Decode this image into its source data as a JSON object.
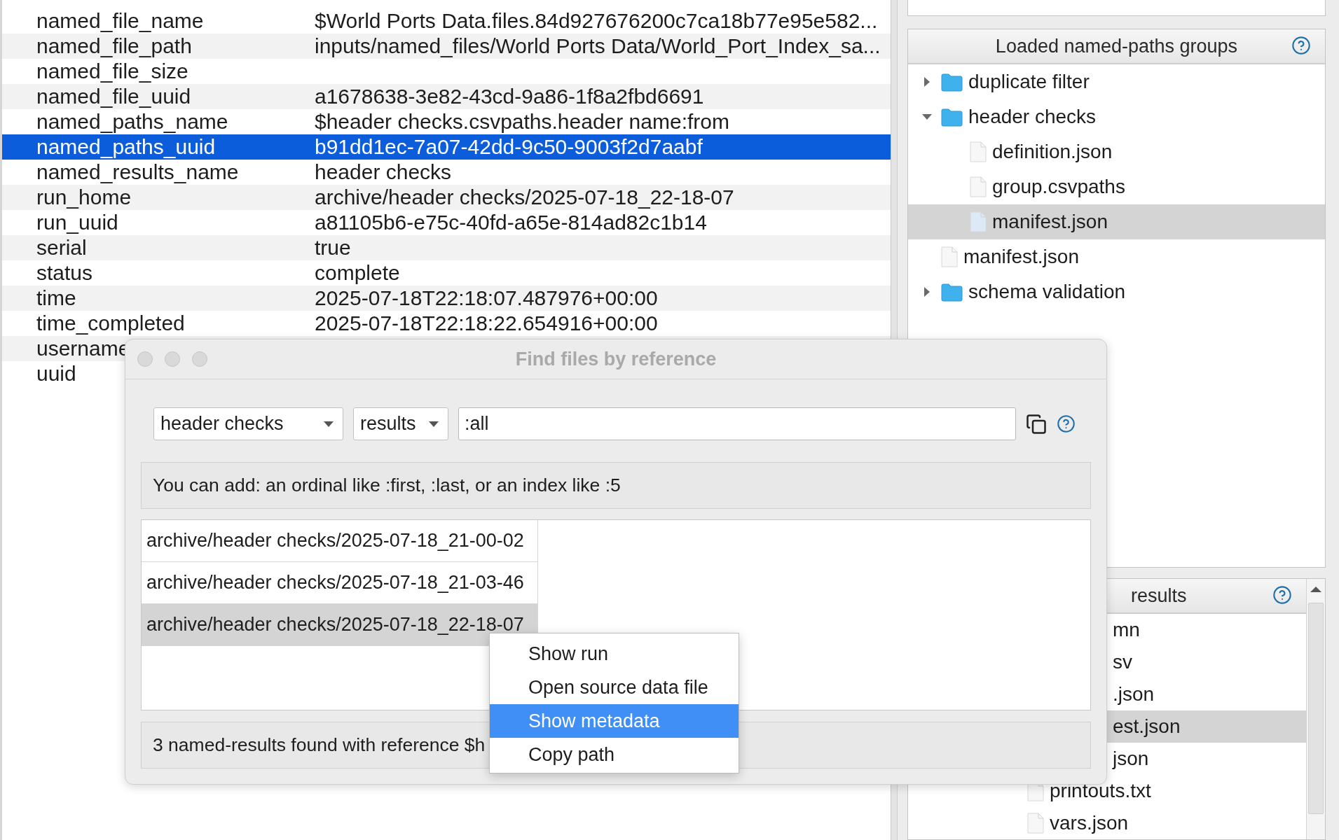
{
  "metadata_table": {
    "rows": [
      {
        "key": "named_file_name",
        "value": "$World Ports Data.files.84d927676200c7ca18b77e95e582...",
        "selected": false
      },
      {
        "key": "named_file_path",
        "value": "inputs/named_files/World Ports Data/World_Port_Index_sa...",
        "selected": false
      },
      {
        "key": "named_file_size",
        "selected": false
      },
      {
        "key": "named_file_uuid",
        "value": "a1678638-3e82-43cd-9a86-1f8a2fbd6691",
        "selected": false
      },
      {
        "key": "named_paths_name",
        "value": "$header checks.csvpaths.header name:from",
        "selected": false
      },
      {
        "key": "named_paths_uuid",
        "value": "b91dd1ec-7a07-42dd-9c50-9003f2d7aabf",
        "selected": true
      },
      {
        "key": "named_results_name",
        "value": "header checks",
        "selected": false
      },
      {
        "key": "run_home",
        "value": "archive/header checks/2025-07-18_22-18-07",
        "selected": false
      },
      {
        "key": "run_uuid",
        "value": "a81105b6-e75c-40fd-a65e-814ad82c1b14",
        "selected": false
      },
      {
        "key": "serial",
        "value": "true",
        "selected": false
      },
      {
        "key": "status",
        "value": "complete",
        "selected": false
      },
      {
        "key": "time",
        "value": "2025-07-18T22:18:07.487976+00:00",
        "selected": false
      },
      {
        "key": "time_completed",
        "value": "2025-07-18T22:18:22.654916+00:00",
        "selected": false
      },
      {
        "key": "username",
        "selected": false
      },
      {
        "key": "uuid",
        "selected": false
      }
    ]
  },
  "named_paths_panel": {
    "title": "Loaded named-paths groups",
    "tree": [
      {
        "label": "duplicate filter",
        "kind": "folder",
        "expanded": false,
        "selected": false
      },
      {
        "label": "header checks",
        "kind": "folder",
        "expanded": true,
        "selected": false,
        "children": [
          {
            "label": "definition.json",
            "kind": "file",
            "selected": false
          },
          {
            "label": "group.csvpaths",
            "kind": "file",
            "selected": false
          },
          {
            "label": "manifest.json",
            "kind": "file",
            "selected": true
          }
        ]
      },
      {
        "label": "manifest.json",
        "kind": "file",
        "selected": false
      },
      {
        "label": "schema validation",
        "kind": "folder",
        "expanded": false,
        "selected": false
      }
    ]
  },
  "results_panel": {
    "title": "results",
    "items": [
      {
        "label": "mn",
        "covered": true,
        "selected": false
      },
      {
        "label": "sv",
        "covered": true,
        "selected": false
      },
      {
        "label": ".json",
        "covered": true,
        "selected": false
      },
      {
        "label": "est.json",
        "covered": true,
        "selected": true
      },
      {
        "label": "json",
        "covered": true,
        "selected": false
      },
      {
        "label": "printouts.txt",
        "covered": false,
        "selected": false
      },
      {
        "label": "vars.json",
        "covered": false,
        "selected": false
      }
    ]
  },
  "dialog": {
    "title": "Find files by reference",
    "group_select": "header checks",
    "type_select": "results",
    "reference_field": ":all",
    "hint": "You can add: an ordinal like :first, :last, or an index like :5",
    "files": [
      {
        "label": "archive/header checks/2025-07-18_21-00-02",
        "selected": false
      },
      {
        "label": "archive/header checks/2025-07-18_21-03-46",
        "selected": false
      },
      {
        "label": "archive/header checks/2025-07-18_22-18-07",
        "selected": true
      }
    ],
    "status": "3 named-results found with reference $h"
  },
  "context_menu": {
    "items": [
      {
        "label": "Show run",
        "selected": false
      },
      {
        "label": "Open source data file",
        "selected": false
      },
      {
        "label": "Show metadata",
        "selected": true
      },
      {
        "label": "Copy path",
        "selected": false
      }
    ]
  }
}
